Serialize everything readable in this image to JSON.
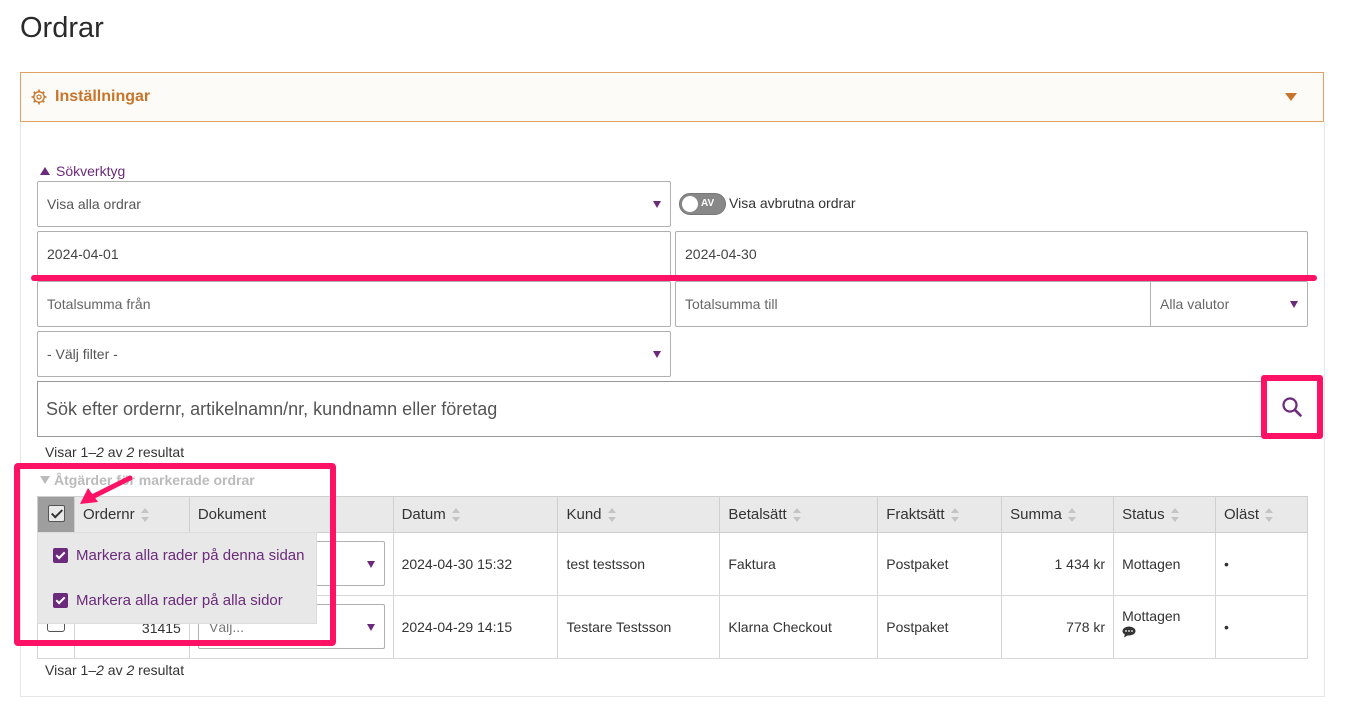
{
  "page": {
    "title": "Ordrar"
  },
  "settings": {
    "label": "Inställningar"
  },
  "search_tools": {
    "toggle_label": "Sökverktyg",
    "order_filter": "Visa alla ordrar",
    "cancelled_toggle_state": "AV",
    "cancelled_toggle_label": "Visa avbrutna ordrar",
    "date_from": "2024-04-01",
    "date_to": "2024-04-30",
    "total_from_placeholder": "Totalsumma från",
    "total_to_placeholder": "Totalsumma till",
    "currency": "Alla valutor",
    "filter": "- Välj filter -",
    "search_placeholder": "Sök efter ordernr, artikelnamn/nr, kundnamn eller företag"
  },
  "results_top": {
    "prefix": "Visar 1–",
    "range_end": "2",
    "mid": " av ",
    "total": "2",
    "suffix": " resultat"
  },
  "results_bottom": {
    "prefix": "Visar 1–",
    "range_end": "2",
    "mid": " av ",
    "total": "2",
    "suffix": " resultat"
  },
  "actions": {
    "toggle_label": "Åtgärder för markerade ordrar"
  },
  "table": {
    "columns": [
      "Ordernr",
      "Dokument",
      "Datum",
      "Kund",
      "Betalsätt",
      "Fraktsätt",
      "Summa",
      "Status",
      "Oläst"
    ],
    "rows": [
      {
        "ordernr": "",
        "document": "",
        "date": "2024-04-30 15:32",
        "customer": "test testsson",
        "payment": "Faktura",
        "shipping": "Postpaket",
        "sum": "1 434 kr",
        "status": "Mottagen",
        "unread": "•"
      },
      {
        "ordernr": "31415",
        "document": "Välj...",
        "date": "2024-04-29 14:15",
        "customer": "Testare Testsson",
        "payment": "Klarna Checkout",
        "shipping": "Postpaket",
        "sum": "778 kr",
        "status": "Mottagen",
        "unread": "•"
      }
    ]
  },
  "select_menu": {
    "item_page": "Markera alla rader på denna sidan",
    "item_all": "Markera alla rader på alla sidor"
  },
  "colors": {
    "accent_purple": "#6b2a7a",
    "accent_orange": "#c8742a",
    "highlight": "#ff1166"
  }
}
